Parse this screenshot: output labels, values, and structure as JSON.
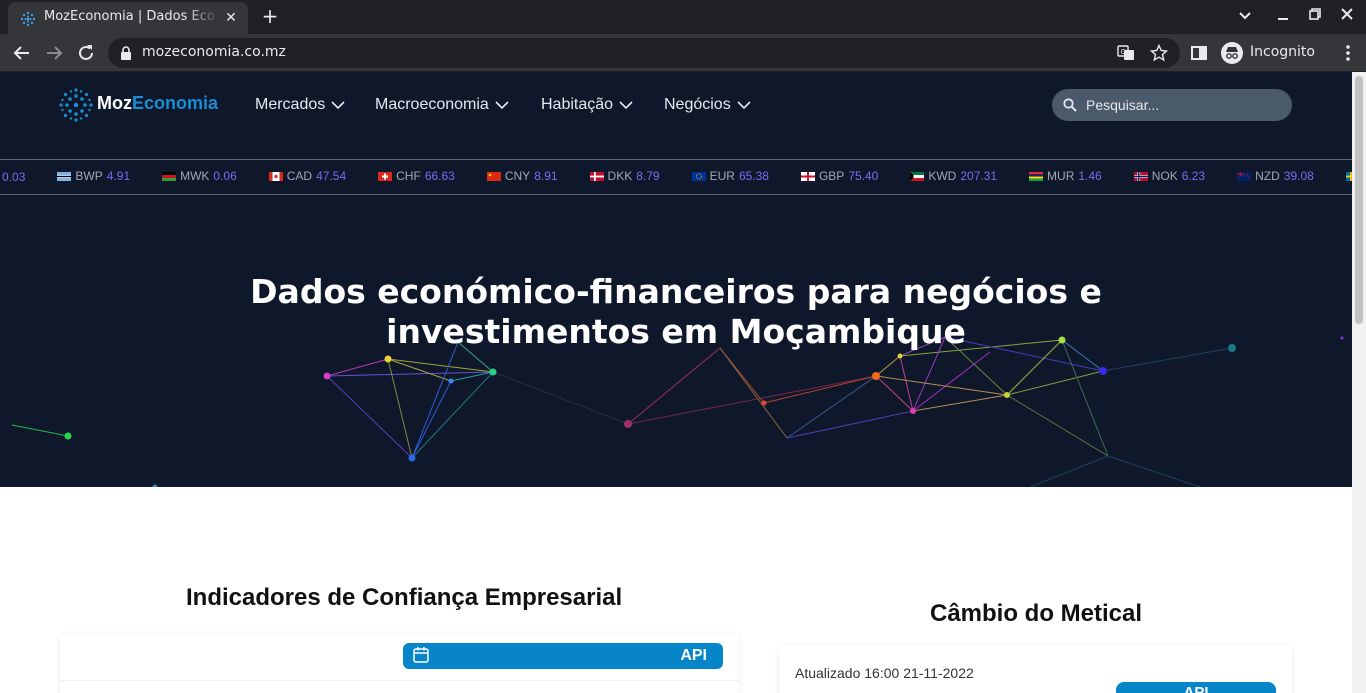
{
  "browser": {
    "tab_title": "MozEconomia | Dados Eco",
    "url": "mozeconomia.co.mz",
    "incognito_label": "Incognito"
  },
  "site": {
    "logo_part1": "Moz",
    "logo_part2": "Economia",
    "nav": [
      {
        "label": "Mercados"
      },
      {
        "label": "Macroeconomia"
      },
      {
        "label": "Habitação"
      },
      {
        "label": "Negócios"
      }
    ],
    "search_placeholder": "Pesquisar...",
    "ticker": [
      {
        "code": "S",
        "value": "0.03",
        "flag": "none"
      },
      {
        "code": "BWP",
        "value": "4.91",
        "flag": "bw"
      },
      {
        "code": "MWK",
        "value": "0.06",
        "flag": "mw"
      },
      {
        "code": "CAD",
        "value": "47.54",
        "flag": "ca"
      },
      {
        "code": "CHF",
        "value": "66.63",
        "flag": "ch"
      },
      {
        "code": "CNY",
        "value": "8.91",
        "flag": "cn"
      },
      {
        "code": "DKK",
        "value": "8.79",
        "flag": "dk"
      },
      {
        "code": "EUR",
        "value": "65.38",
        "flag": "eu"
      },
      {
        "code": "GBP",
        "value": "75.40",
        "flag": "gb"
      },
      {
        "code": "KWD",
        "value": "207.31",
        "flag": "kw"
      },
      {
        "code": "MUR",
        "value": "1.46",
        "flag": "mu"
      },
      {
        "code": "NOK",
        "value": "6.23",
        "flag": "no"
      },
      {
        "code": "NZD",
        "value": "39.08",
        "flag": "nz"
      },
      {
        "code": "",
        "value": "",
        "flag": "se"
      }
    ],
    "headline_line1": "Dados económico-financeiros para negócios e",
    "headline_line2": "investimentos em Moçambique",
    "section_confidence_title": "Indicadores de Confiança Empresarial",
    "api_label": "API",
    "section_exchange_title": "Câmbio do Metical",
    "updated_text": "Atualizado 16:00 21-11-2022",
    "api_button2": "API"
  },
  "colors": {
    "hero_bg": "#0f172b",
    "brand_blue": "#1a8ed4",
    "api_blue": "#0686c8",
    "ticker_value": "#7b6cf0"
  }
}
